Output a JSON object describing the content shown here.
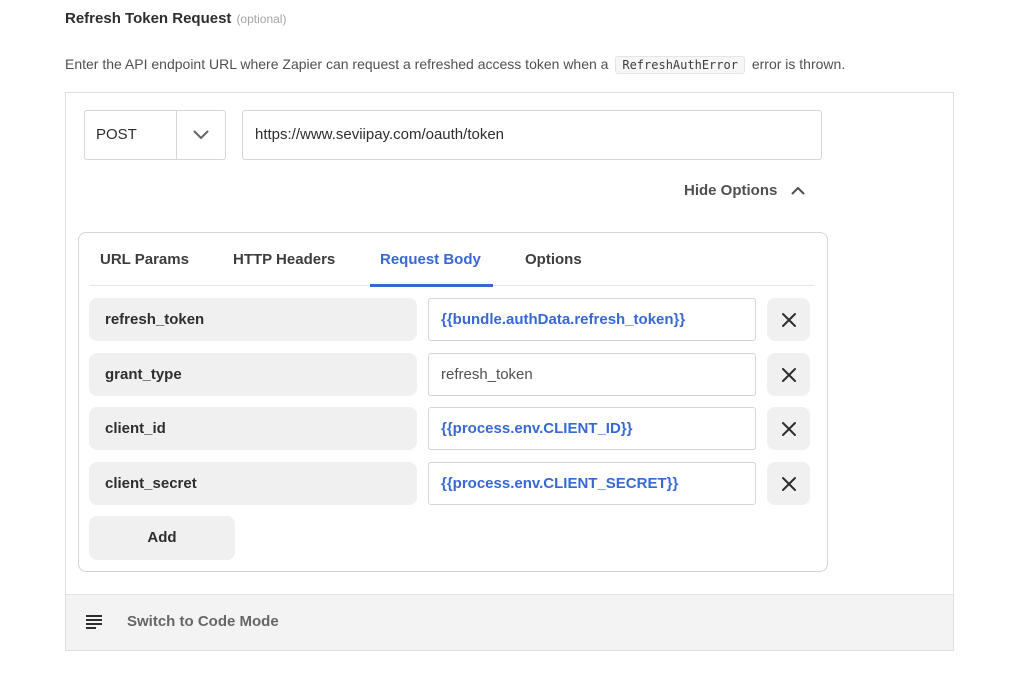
{
  "section": {
    "title": "Refresh Token Request",
    "optional_label": "(optional)",
    "description_before": "Enter the API endpoint URL where Zapier can request a refreshed access token when a",
    "description_code": "RefreshAuthError",
    "description_after": "error is thrown."
  },
  "request": {
    "method": "POST",
    "url": "https://www.seviipay.com/oauth/token"
  },
  "options_toggle": {
    "label": "Hide Options"
  },
  "tabs": [
    {
      "label": "URL Params",
      "active": false
    },
    {
      "label": "HTTP Headers",
      "active": false
    },
    {
      "label": "Request Body",
      "active": true
    },
    {
      "label": "Options",
      "active": false
    }
  ],
  "body_fields": [
    {
      "key": "refresh_token",
      "value": "{{bundle.authData.refresh_token}}",
      "templated": true
    },
    {
      "key": "grant_type",
      "value": "refresh_token",
      "templated": false
    },
    {
      "key": "client_id",
      "value": "{{process.env.CLIENT_ID}}",
      "templated": true
    },
    {
      "key": "client_secret",
      "value": "{{process.env.CLIENT_SECRET}}",
      "templated": true
    }
  ],
  "add_button": {
    "label": "Add"
  },
  "footer": {
    "label": "Switch to Code Mode",
    "icon": "lines-icon"
  },
  "colors": {
    "accent": "#3769d4",
    "key_bg": "#f0f0f0",
    "footer_bg": "#f3f3f3"
  }
}
